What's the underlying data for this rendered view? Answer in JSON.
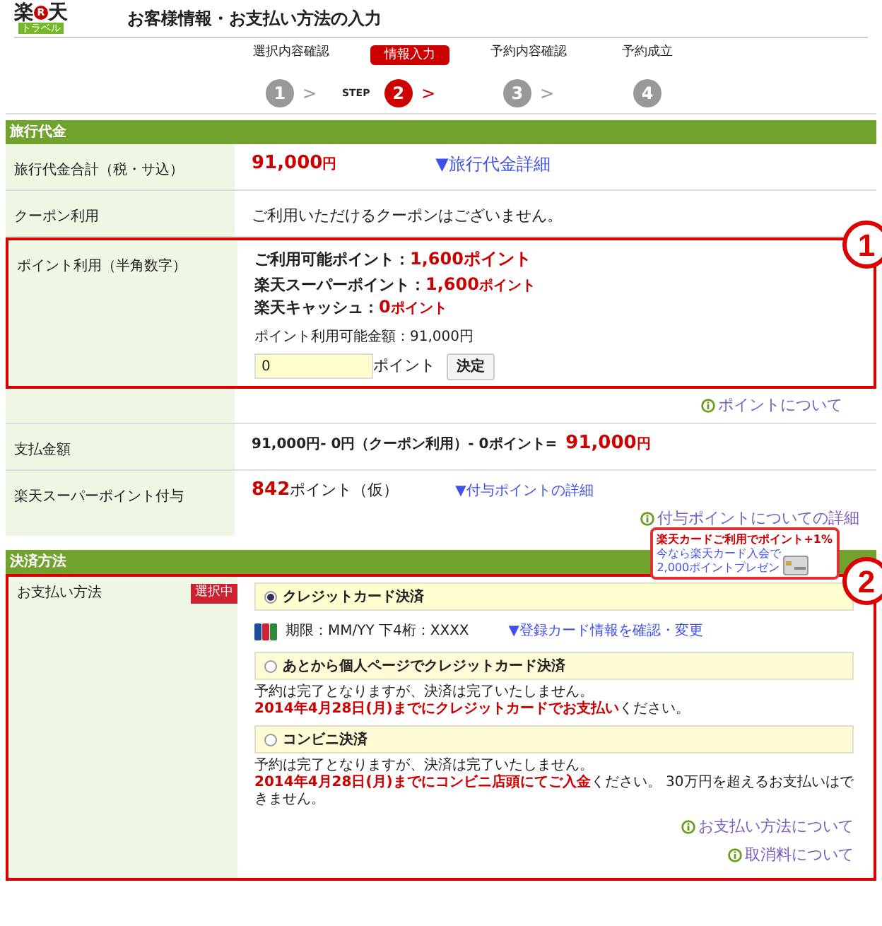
{
  "logo": {
    "left": "楽",
    "mark": "R",
    "right": "天",
    "sub": "トラベル"
  },
  "page_title": "お客様情報・お支払い方法の入力",
  "steps": [
    {
      "label": "選択内容確認",
      "number": "1",
      "selected": false,
      "arrow": ">"
    },
    {
      "label": "情報入力",
      "number": "2",
      "selected": true,
      "arrow": ">",
      "prefix": "STEP"
    },
    {
      "label": "予約内容確認",
      "number": "3",
      "selected": false,
      "arrow": ">"
    },
    {
      "label": "予約成立",
      "number": "4",
      "selected": false
    }
  ],
  "fee_section": {
    "title": "旅行代金",
    "total": {
      "label": "旅行代金合計（税・サ込）",
      "amount": "91,000",
      "unit": "円",
      "link": "▼旅行代金詳細"
    },
    "coupon": {
      "label": "クーポン利用",
      "text": "ご利用いただけるクーポンはございません。"
    },
    "points": {
      "label": "ポイント利用（半角数字）",
      "annotation": "1",
      "available": {
        "label": "ご利用可能ポイント：",
        "value": "1,600ポイント"
      },
      "breakdown": [
        {
          "label": "楽天スーパーポイント：",
          "value": "1,600",
          "unit": "ポイント"
        },
        {
          "label": "楽天キャッシュ：",
          "value": "0",
          "unit": "ポイント"
        }
      ],
      "usable_amount": "ポイント利用可能金額：91,000円",
      "input": {
        "value": "0",
        "suffix": "ポイント",
        "button": "決定"
      },
      "info_link": "ポイントについて"
    },
    "payment": {
      "label": "支払金額",
      "formula": "91,000円- 0円（クーポン利用）- 0ポイント=",
      "amount": "91,000",
      "unit": "円"
    },
    "grant": {
      "label": "楽天スーパーポイント付与",
      "amount": "842",
      "unit": "ポイント（仮）",
      "link": "▼付与ポイントの詳細",
      "info_link": "付与ポイントについての詳細"
    }
  },
  "payment_section": {
    "title": "決済方法",
    "label": "お支払い方法",
    "annotation": "2",
    "promo": {
      "headline": "楽天カードご利用でポイント+1%",
      "lines": [
        "今なら楽天カード入会で",
        "2,000ポイントプレゼン"
      ]
    },
    "badge": "選択中",
    "methods": [
      {
        "label": "クレジットカード決済",
        "selected": true,
        "card": {
          "text": "期限：MM/YY 下4桁：XXXX",
          "link": "▼登録カード情報を確認・変更"
        }
      },
      {
        "label": "あとから個人ページでクレジットカード決済",
        "selected": false,
        "note": "予約は完了となりますが、決済は完了いたしません。",
        "deadline": "2014年4月28日(月)までにクレジットカードでお支払い",
        "after": "ください。"
      },
      {
        "label": "コンビニ決済",
        "selected": false,
        "note": "予約は完了となりますが、決済は完了いたしません。",
        "deadline": "2014年4月28日(月)までにコンビニ店頭にてご入金",
        "after": "ください。 30万円を超えるお支払いはできません。"
      }
    ],
    "info_links": [
      "お支払い方法について",
      "取消料について"
    ]
  }
}
